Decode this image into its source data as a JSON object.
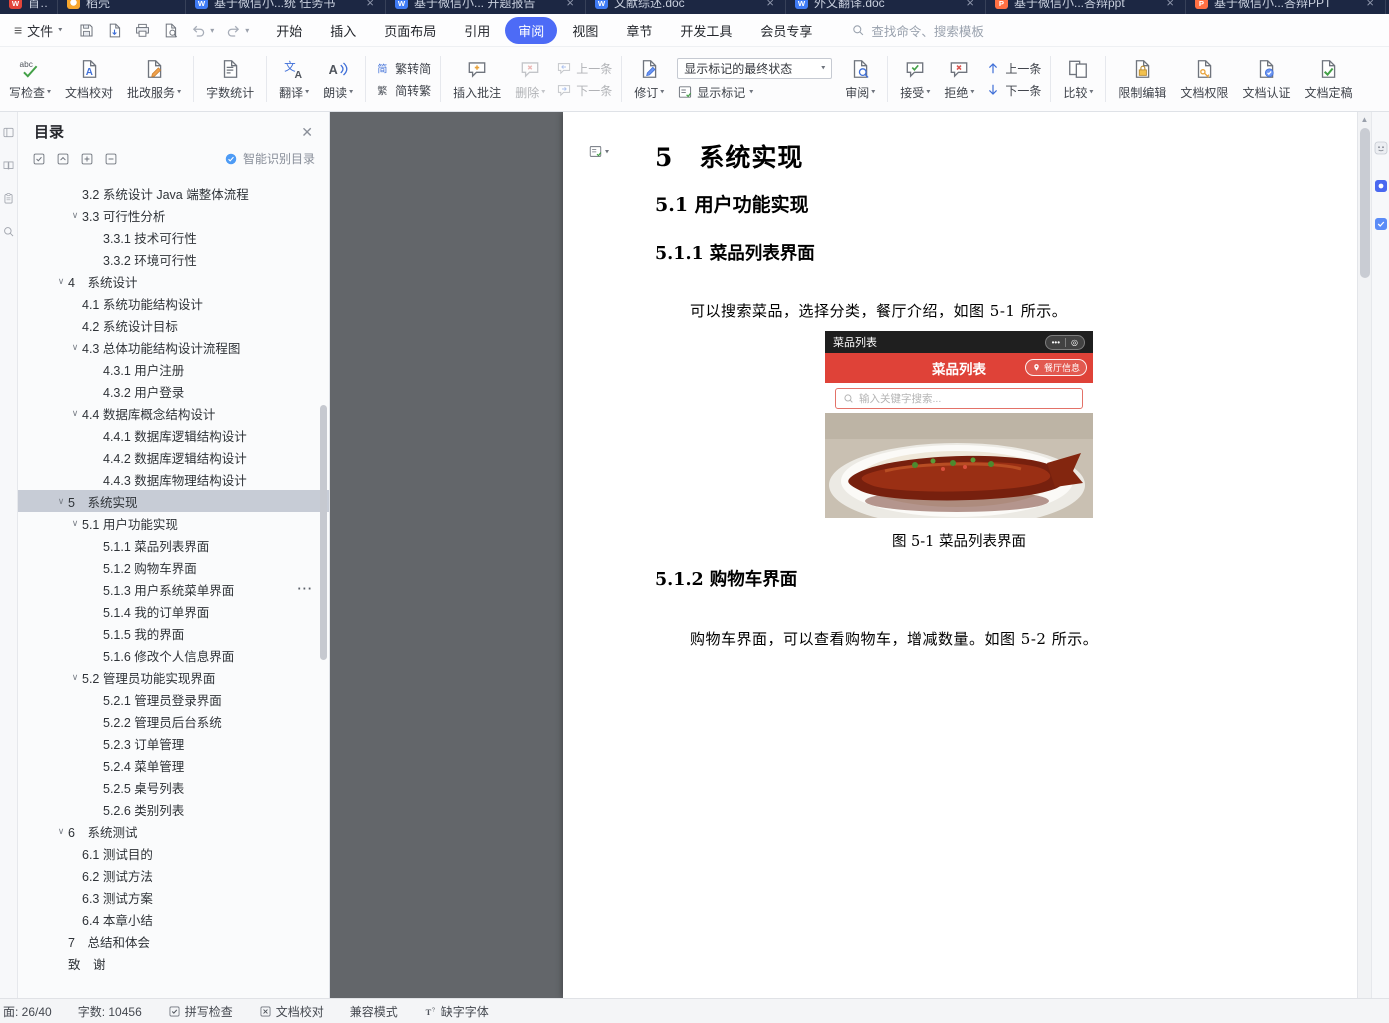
{
  "window": {
    "tabs": [
      {
        "label": "首页",
        "icon": "wps-home",
        "close": false
      },
      {
        "label": "稻壳",
        "icon": "docer",
        "close": false
      },
      {
        "label": "基于微信小...统 任务书",
        "icon": "doc",
        "close": true
      },
      {
        "label": "基于微信小... 开题报告",
        "icon": "doc",
        "close": true
      },
      {
        "label": "文献综述.doc",
        "icon": "doc",
        "close": true
      },
      {
        "label": "外文翻译.doc",
        "icon": "doc",
        "close": true
      },
      {
        "label": "基于微信小...答辩ppt",
        "icon": "ppt",
        "close": true
      },
      {
        "label": "基于微信小...答辩PPT",
        "icon": "ppt",
        "close": true
      }
    ]
  },
  "menu": {
    "file_label": "文件",
    "items": [
      "开始",
      "插入",
      "页面布局",
      "引用",
      "审阅",
      "视图",
      "章节",
      "开发工具",
      "会员专享"
    ],
    "active_item": "审阅",
    "search_placeholder": "查找命令、搜索模板",
    "quick_actions": [
      "save",
      "export",
      "print",
      "preview",
      "undo",
      "redo"
    ]
  },
  "ribbon": {
    "markup_state_value": "显示标记的最终状态",
    "groups": [
      {
        "items": [
          {
            "type": "big",
            "id": "spellcheck",
            "label": "写检查",
            "icon": "spellcheck",
            "caret": true
          },
          {
            "type": "big",
            "id": "proofread",
            "label": "文档校对",
            "icon": "proofread"
          },
          {
            "type": "big",
            "id": "grading",
            "label": "批改服务",
            "icon": "grading",
            "caret": true
          }
        ]
      },
      {
        "items": [
          {
            "type": "big",
            "id": "word-count",
            "label": "字数统计",
            "icon": "wordcount"
          }
        ]
      },
      {
        "items": [
          {
            "type": "big",
            "id": "translate",
            "label": "翻译",
            "icon": "translate",
            "caret": true
          },
          {
            "type": "big",
            "id": "read-aloud",
            "label": "朗读",
            "icon": "readaloud",
            "caret": true
          }
        ]
      },
      {
        "items": [
          {
            "type": "stack",
            "rows": [
              {
                "id": "trad-to-simp",
                "label": "繁转简",
                "icon": "fanjian"
              },
              {
                "id": "simp-to-trad",
                "label": "简转繁",
                "icon": "jianfan"
              }
            ]
          }
        ]
      },
      {
        "items": [
          {
            "type": "big",
            "id": "insert-comment",
            "label": "插入批注",
            "icon": "comment-add"
          },
          {
            "type": "big",
            "id": "delete-comment",
            "label": "删除",
            "icon": "comment-del",
            "caret": true,
            "disabled": true
          },
          {
            "type": "stack",
            "rows": [
              {
                "id": "prev-comment",
                "label": "上一条",
                "icon": "comment-prev",
                "disabled": true
              },
              {
                "id": "next-comment",
                "label": "下一条",
                "icon": "comment-next",
                "disabled": true
              }
            ]
          }
        ]
      },
      {
        "items": [
          {
            "type": "big",
            "id": "track-changes",
            "label": "修订",
            "icon": "track",
            "caret": true
          },
          {
            "type": "combo",
            "id": "markup-state",
            "below": {
              "id": "show-markup",
              "label": "显示标记",
              "icon": "markup",
              "caret": true
            }
          },
          {
            "type": "big",
            "id": "review",
            "label": "审阅",
            "icon": "review",
            "caret": true
          }
        ]
      },
      {
        "items": [
          {
            "type": "big",
            "id": "accept",
            "label": "接受",
            "icon": "accept",
            "caret": true
          },
          {
            "type": "big",
            "id": "reject",
            "label": "拒绝",
            "icon": "reject",
            "caret": true
          },
          {
            "type": "stack",
            "rows": [
              {
                "id": "prev-change",
                "label": "上一条",
                "icon": "nav-prev"
              },
              {
                "id": "next-change",
                "label": "下一条",
                "icon": "nav-next"
              }
            ]
          }
        ]
      },
      {
        "items": [
          {
            "type": "big",
            "id": "compare",
            "label": "比较",
            "icon": "compare",
            "caret": true
          }
        ]
      },
      {
        "items": [
          {
            "type": "big",
            "id": "restrict-edit",
            "label": "限制编辑",
            "icon": "restrict"
          },
          {
            "type": "big",
            "id": "doc-permission",
            "label": "文档权限",
            "icon": "permission"
          },
          {
            "type": "big",
            "id": "doc-certify",
            "label": "文档认证",
            "icon": "certify"
          },
          {
            "type": "big",
            "id": "doc-final",
            "label": "文档定稿",
            "icon": "final"
          }
        ]
      }
    ]
  },
  "toc": {
    "title": "目录",
    "smart_label": "智能识别目录",
    "tool_icons": [
      "checkbox",
      "chevron-up-sq",
      "plus-sq",
      "minus-sq"
    ],
    "items": [
      {
        "label": "3.2 系统设计 Java 端整体流程",
        "level": 2
      },
      {
        "label": "3.3 可行性分析",
        "level": 2,
        "chevron": true
      },
      {
        "label": "3.3.1 技术可行性",
        "level": 3
      },
      {
        "label": "3.3.2 环境可行性",
        "level": 3
      },
      {
        "label": "4　系统设计",
        "level": 1,
        "chevron": true
      },
      {
        "label": "4.1 系统功能结构设计",
        "level": 2
      },
      {
        "label": "4.2 系统设计目标",
        "level": 2
      },
      {
        "label": "4.3 总体功能结构设计流程图",
        "level": 2,
        "chevron": true
      },
      {
        "label": "4.3.1 用户注册",
        "level": 3
      },
      {
        "label": "4.3.2 用户登录",
        "level": 3
      },
      {
        "label": "4.4 数据库概念结构设计",
        "level": 2,
        "chevron": true
      },
      {
        "label": "4.4.1 数据库逻辑结构设计",
        "level": 3
      },
      {
        "label": "4.4.2 数据库逻辑结构设计",
        "level": 3
      },
      {
        "label": "4.4.3 数据库物理结构设计",
        "level": 3
      },
      {
        "label": "5　系统实现",
        "level": 1,
        "chevron": true,
        "selected": true
      },
      {
        "label": "5.1 用户功能实现",
        "level": 2,
        "chevron": true
      },
      {
        "label": "5.1.1 菜品列表界面",
        "level": 3
      },
      {
        "label": "5.1.2 购物车界面",
        "level": 3
      },
      {
        "label": "5.1.3 用户系统菜单界面",
        "level": 3,
        "more": true
      },
      {
        "label": "5.1.4 我的订单界面",
        "level": 3
      },
      {
        "label": "5.1.5 我的界面",
        "level": 3
      },
      {
        "label": "5.1.6 修改个人信息界面",
        "level": 3
      },
      {
        "label": "5.2 管理员功能实现界面",
        "level": 2,
        "chevron": true
      },
      {
        "label": "5.2.1 管理员登录界面",
        "level": 3
      },
      {
        "label": "5.2.2 管理员后台系统",
        "level": 3
      },
      {
        "label": "5.2.3 订单管理",
        "level": 3
      },
      {
        "label": "5.2.4 菜单管理",
        "level": 3
      },
      {
        "label": "5.2.5 桌号列表",
        "level": 3
      },
      {
        "label": "5.2.6 类别列表",
        "level": 3
      },
      {
        "label": "6　系统测试",
        "level": 1,
        "chevron": true
      },
      {
        "label": "6.1 测试目的",
        "level": 2
      },
      {
        "label": "6.2 测试方法",
        "level": 2
      },
      {
        "label": "6.3 测试方案",
        "level": 2
      },
      {
        "label": "6.4 本章小结",
        "level": 2
      },
      {
        "label": "7　总结和体会",
        "level": 1
      },
      {
        "label": "致　谢",
        "level": 1
      }
    ]
  },
  "left_strip_icons": [
    "panel",
    "book",
    "clipboard",
    "find"
  ],
  "right_strip_icons": [
    "helper",
    "ai-blue",
    "ai-light"
  ],
  "document": {
    "h1": "5　系统实现",
    "h2": "5.1 用户功能实现",
    "h3a": "5.1.1 菜品列表界面",
    "p1": "可以搜索菜品，选择分类，餐厅介绍，如图 5-1 所示。",
    "figure_caption": "图 5-1 菜品列表界面",
    "h3b": "5.1.2 购物车界面",
    "p2": "购物车界面，可以查看购物车，增减数量。如图 5-2 所示。",
    "figure": {
      "app_title": "菜品列表",
      "header_title": "菜品列表",
      "restaurant_info": "餐厅信息",
      "search_placeholder": "输入关键字搜索...",
      "capsule_dots": "•••",
      "capsule_target": "◎"
    }
  },
  "status_bar": {
    "items": [
      {
        "label": "面: 26/40",
        "icon": null
      },
      {
        "label": "字数: 10456",
        "icon": null
      },
      {
        "label": "拼写检查",
        "icon": "check-box"
      },
      {
        "label": "文档校对",
        "icon": "x-box"
      },
      {
        "label": "兼容模式",
        "icon": null
      },
      {
        "label": "缺字字体",
        "icon": "missing-font"
      }
    ]
  },
  "colors": {
    "accent_blue": "#4d6bf6",
    "tabbar_bg": "#1c2743",
    "miniprogram_red": "#df4238",
    "toc_selected_bg": "#c7ccd6"
  }
}
